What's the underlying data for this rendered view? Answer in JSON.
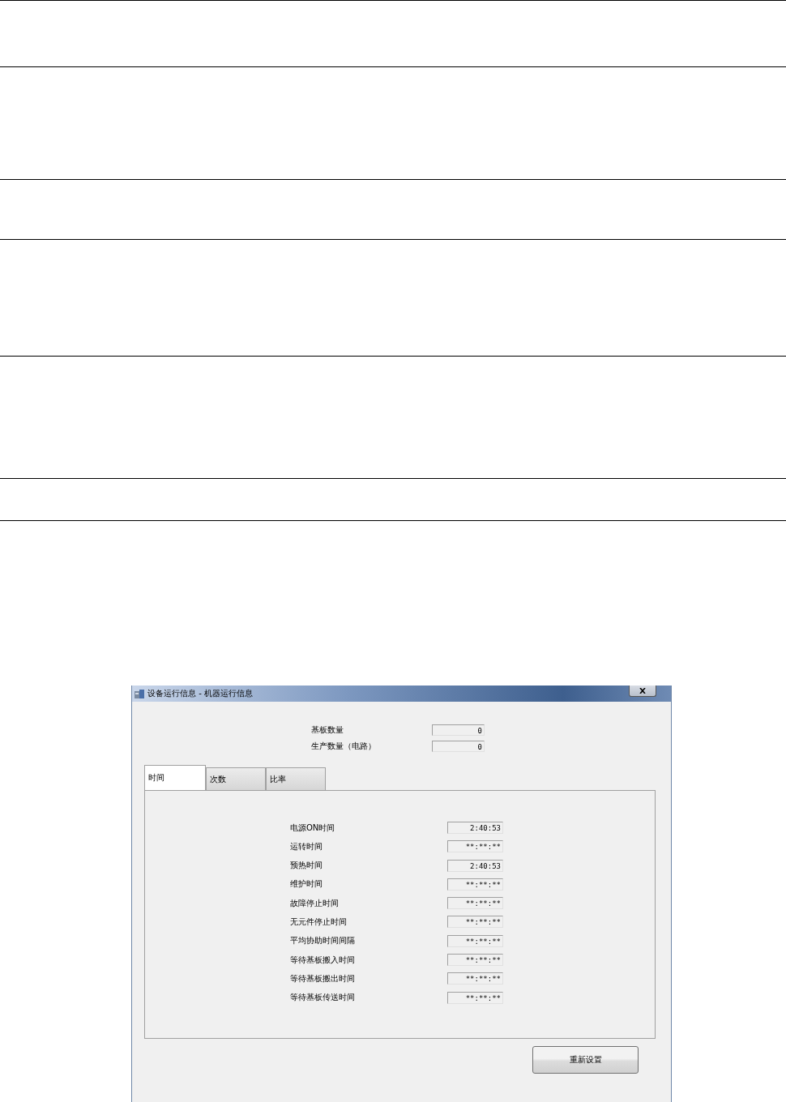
{
  "window": {
    "title": "设备运行信息 - 机器运行信息"
  },
  "summary": [
    {
      "label": "基板数量",
      "value": "0"
    },
    {
      "label": "生产数量（电路）",
      "value": "0"
    }
  ],
  "tabs": [
    {
      "label": "时间",
      "selected": true
    },
    {
      "label": "次数",
      "selected": false
    },
    {
      "label": "比率",
      "selected": false
    }
  ],
  "time_fields": [
    {
      "label": "电源ON时间",
      "value": "2:40:53"
    },
    {
      "label": "运转时间",
      "value": "**:**:**"
    },
    {
      "label": "预热时间",
      "value": "2:40:53"
    },
    {
      "label": "维护时间",
      "value": "**:**:**"
    },
    {
      "label": "故障停止时间",
      "value": "**:**:**"
    },
    {
      "label": "无元件停止时间",
      "value": "**:**:**"
    },
    {
      "label": "平均协助时间间隔",
      "value": "**:**:**"
    },
    {
      "label": "等待基板搬入时间",
      "value": "**:**:**"
    },
    {
      "label": "等待基板搬出时间",
      "value": "**:**:**"
    },
    {
      "label": "等待基板传送时间",
      "value": "**:**:**"
    }
  ],
  "buttons": [
    {
      "label": "重新设置"
    }
  ]
}
